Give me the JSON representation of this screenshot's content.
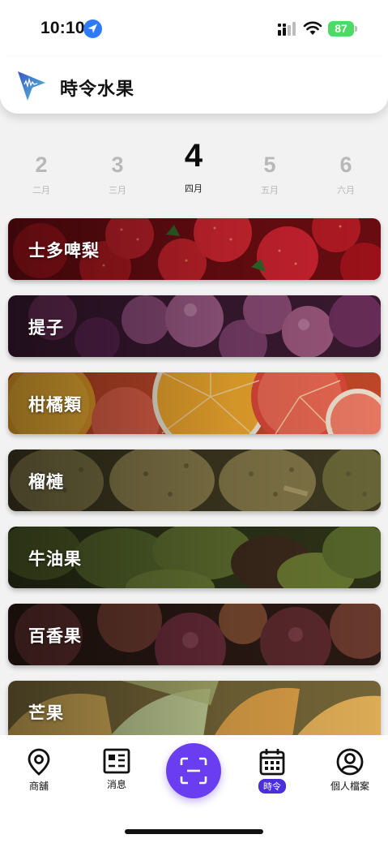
{
  "status_bar": {
    "time": "10:10",
    "battery": "87",
    "icons": [
      "location-arrow-icon",
      "signal-icon",
      "wifi-icon",
      "battery-icon"
    ]
  },
  "header": {
    "title": "時令水果",
    "logo_icon": "arrow-logo-icon"
  },
  "months": [
    {
      "number": "2",
      "label": "二月"
    },
    {
      "number": "3",
      "label": "三月"
    },
    {
      "number": "4",
      "label": "四月",
      "active": true
    },
    {
      "number": "5",
      "label": "五月"
    },
    {
      "number": "6",
      "label": "六月"
    }
  ],
  "fruits": [
    {
      "name": "士多啤梨",
      "image": "strawberries"
    },
    {
      "name": "提子",
      "image": "grapes"
    },
    {
      "name": "柑橘類",
      "image": "citrus"
    },
    {
      "name": "榴槤",
      "image": "durian"
    },
    {
      "name": "牛油果",
      "image": "avocado"
    },
    {
      "name": "百香果",
      "image": "passion-fruit"
    },
    {
      "name": "芒果",
      "image": "mango"
    }
  ],
  "tab_bar": {
    "items": [
      {
        "label": "商舖",
        "icon": "map-pin-icon"
      },
      {
        "label": "消息",
        "icon": "news-icon"
      },
      {
        "label": "",
        "icon": "scan-icon"
      },
      {
        "label": "時令",
        "icon": "calendar-icon",
        "active": true
      },
      {
        "label": "個人檔案",
        "icon": "profile-icon"
      }
    ]
  },
  "colors": {
    "accent": "#6a3df0",
    "active_tab_badge": "#4b2fd8",
    "battery": "#4cd964"
  }
}
